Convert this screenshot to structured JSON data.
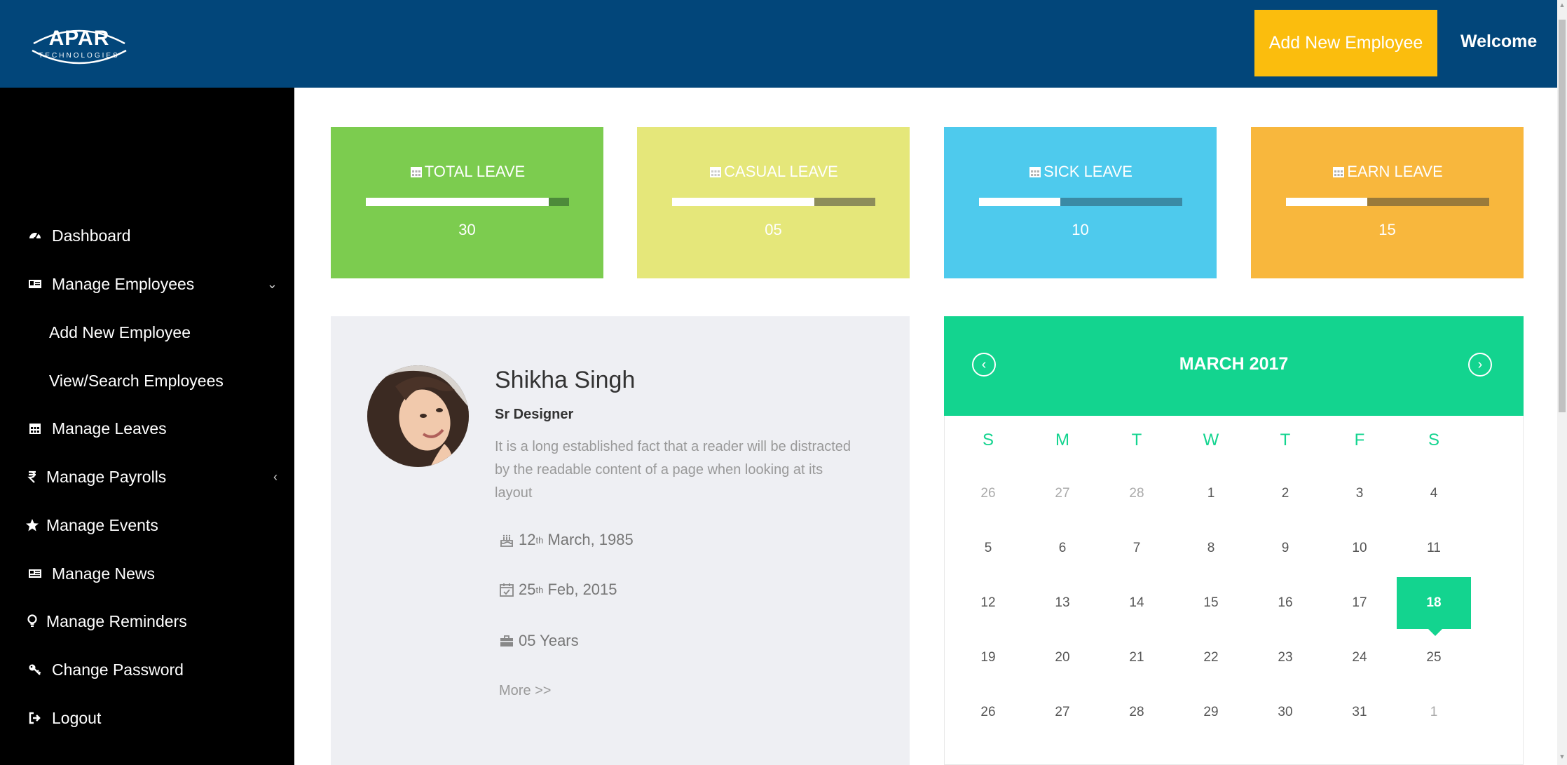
{
  "header": {
    "logo_main": "APAR",
    "logo_sub": "TECHNOLOGIES",
    "add_button": "Add New Employee",
    "welcome": "Welcome"
  },
  "sidebar": {
    "items": [
      {
        "label": "Dashboard",
        "icon": "dashboard-icon"
      },
      {
        "label": "Manage Employees",
        "icon": "id-card-icon",
        "arrow": "⌄"
      },
      {
        "label": "Add New Employee"
      },
      {
        "label": "View/Search Employees"
      },
      {
        "label": "Manage Leaves",
        "icon": "calendar-icon"
      },
      {
        "label": "Manage Payrolls",
        "icon": "rupee-icon",
        "arrow": "‹"
      },
      {
        "label": "Manage Events",
        "icon": "star-icon"
      },
      {
        "label": "Manage News",
        "icon": "newspaper-icon"
      },
      {
        "label": "Manage Reminders",
        "icon": "bulb-icon"
      },
      {
        "label": "Change Password",
        "icon": "key-icon"
      },
      {
        "label": "Logout",
        "icon": "logout-icon"
      }
    ]
  },
  "cards": [
    {
      "title": "TOTAL LEAVE",
      "value": "30",
      "progress": 0.9,
      "bg": "#7ccc4f",
      "track": "#4d8a3a"
    },
    {
      "title": "CASUAL LEAVE",
      "value": "05",
      "progress": 0.7,
      "bg": "#e5e77a",
      "track": "#8d8d5a"
    },
    {
      "title": "SICK LEAVE",
      "value": "10",
      "progress": 0.4,
      "bg": "#4ecaed",
      "track": "#3a8aa5"
    },
    {
      "title": "EARN LEAVE",
      "value": "15",
      "progress": 0.4,
      "bg": "#f8b73d",
      "track": "#9a7a3a"
    }
  ],
  "profile": {
    "name": "Shikha Singh",
    "role": "Sr Designer",
    "description": "It is a long established fact that a reader will be distracted by the readable content of a page when looking at its layout",
    "dob_day": "12",
    "dob_suffix": "th",
    "dob_rest": " March, 1985",
    "join_day": "25",
    "join_suffix": "th",
    "join_rest": " Feb, 2015",
    "experience": "05 Years",
    "more": "More >>"
  },
  "calendar": {
    "title": "MARCH 2017",
    "prev": "‹",
    "next": "›",
    "weekdays": [
      "S",
      "M",
      "T",
      "W",
      "T",
      "F",
      "S"
    ],
    "weeks": [
      [
        "26",
        "27",
        "28",
        "1",
        "2",
        "3",
        "4"
      ],
      [
        "5",
        "6",
        "7",
        "8",
        "9",
        "10",
        "11"
      ],
      [
        "12",
        "13",
        "14",
        "15",
        "16",
        "17",
        "18"
      ],
      [
        "19",
        "20",
        "21",
        "22",
        "23",
        "24",
        "25"
      ],
      [
        "26",
        "27",
        "28",
        "29",
        "30",
        "31",
        "1"
      ]
    ],
    "selected": "18"
  }
}
